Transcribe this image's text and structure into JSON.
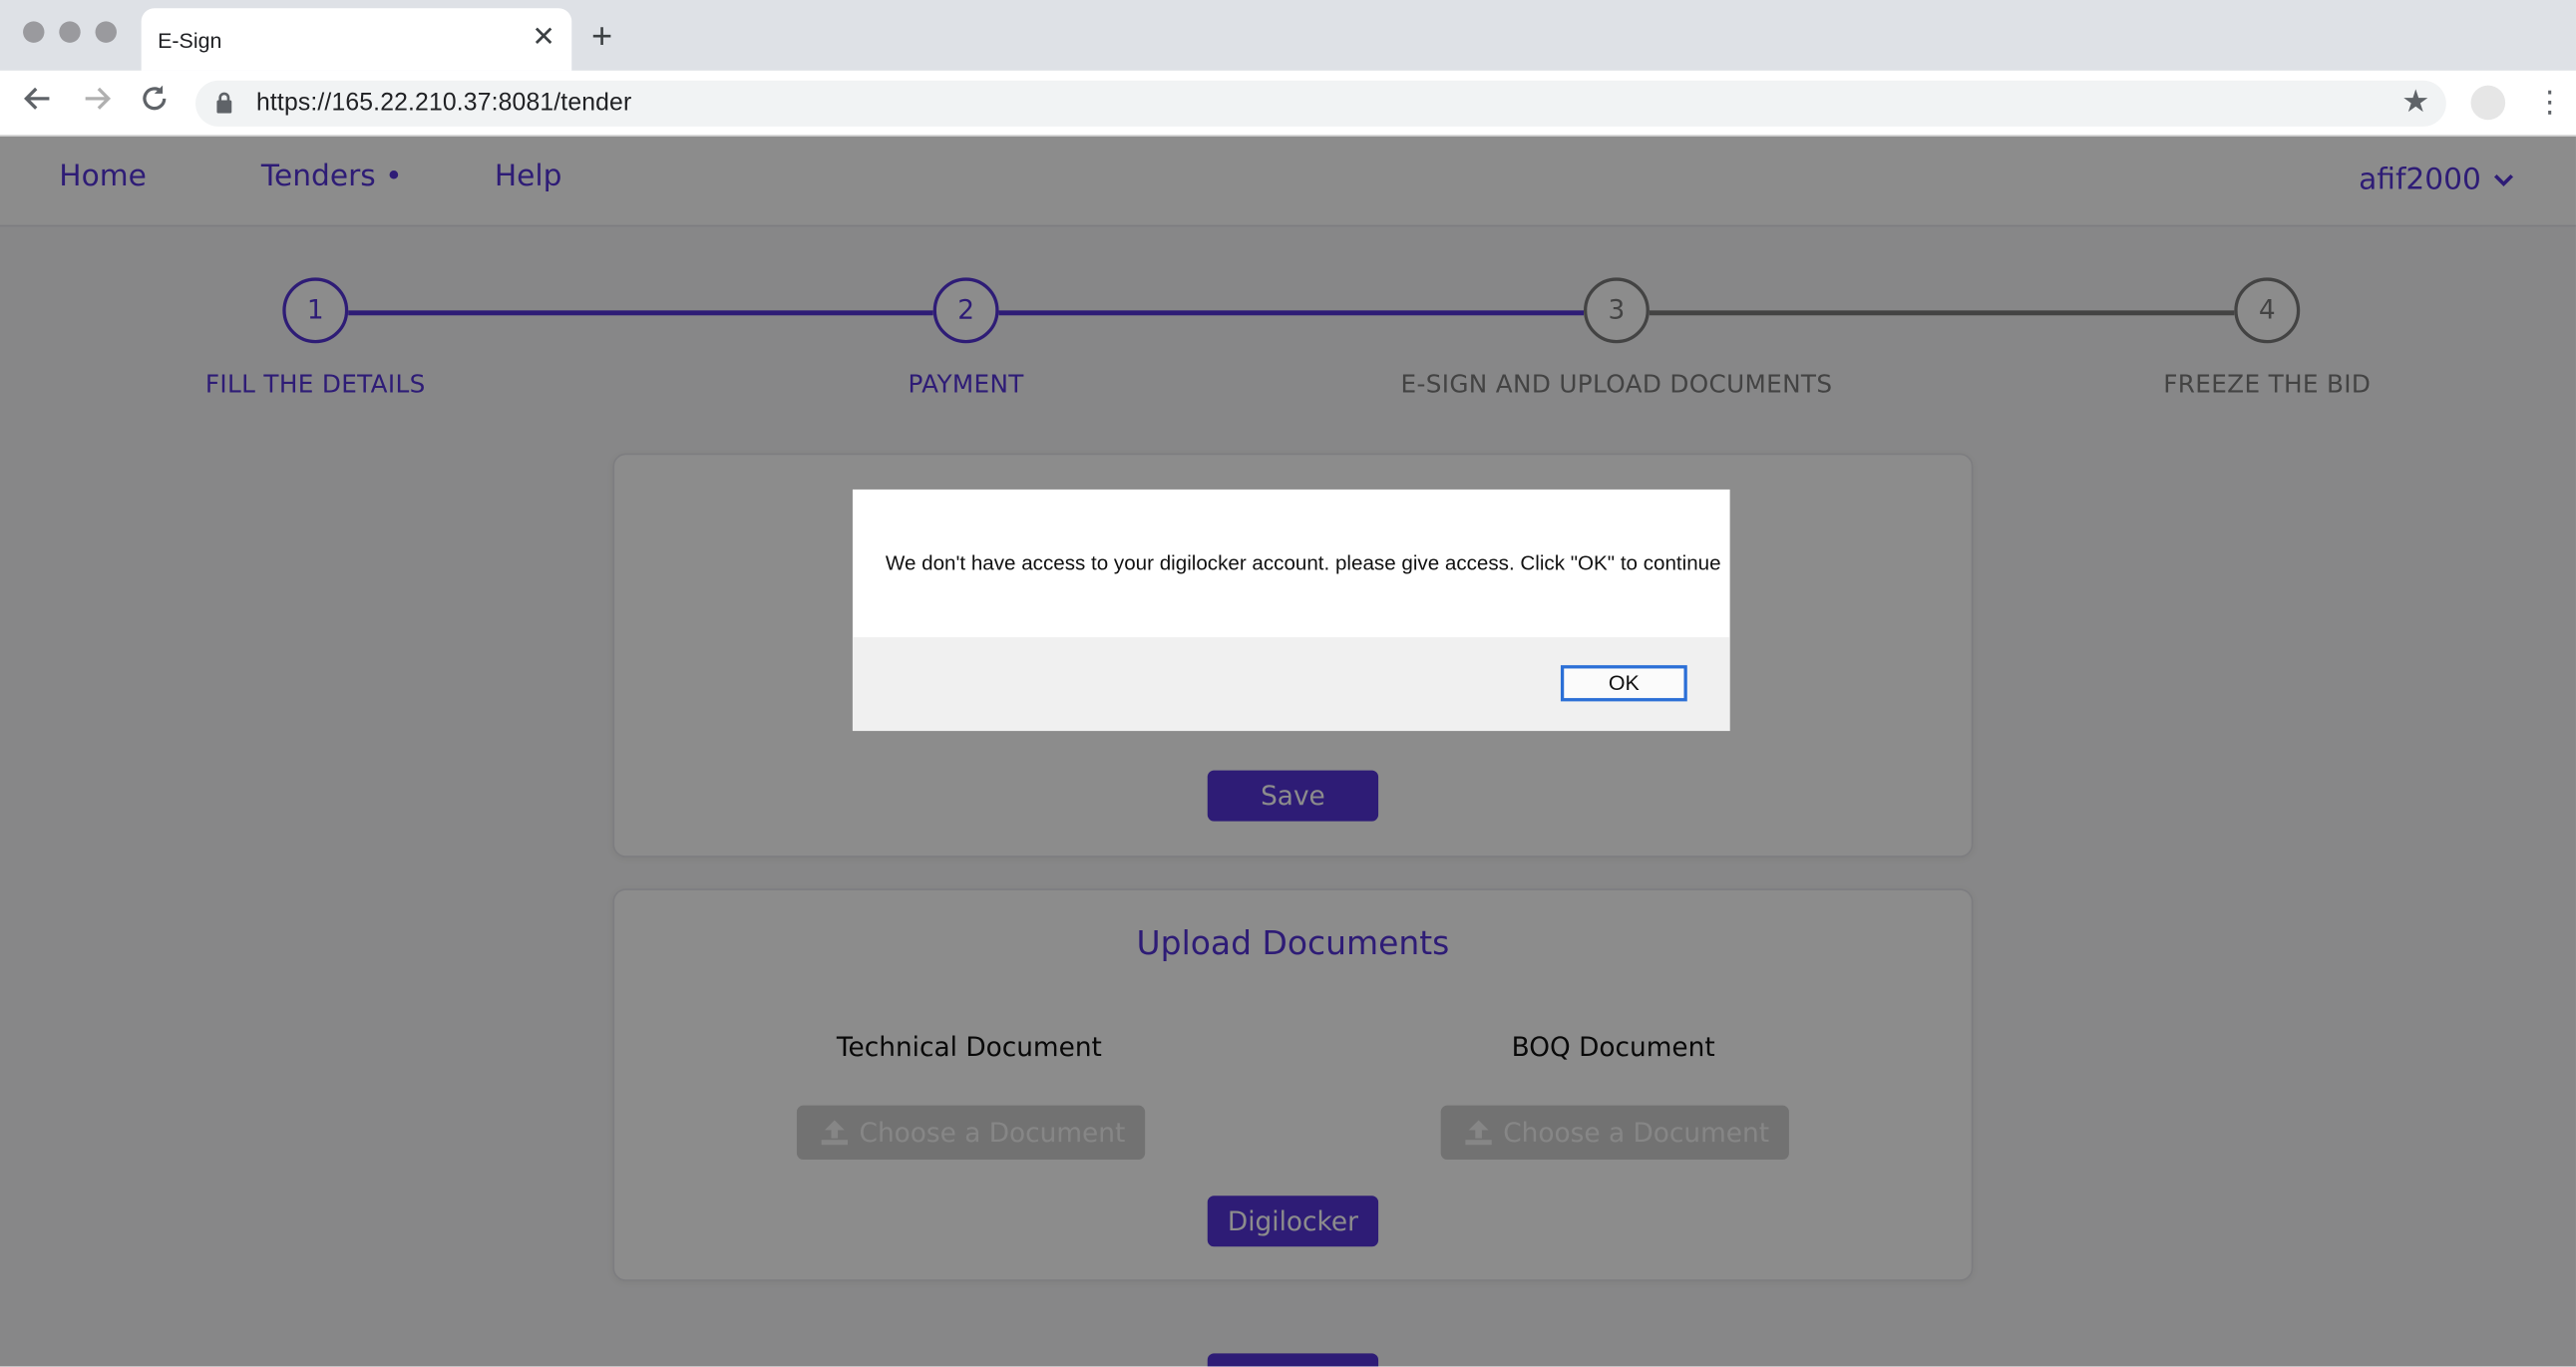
{
  "browser": {
    "tab_title": "E-Sign",
    "url": "https://165.22.210.37:8081/tender"
  },
  "nav": {
    "home": "Home",
    "tenders": "Tenders •",
    "help": "Help",
    "user": "afif2000"
  },
  "stepper": {
    "steps": [
      {
        "number": "1",
        "label": "FILL THE DETAILS",
        "state": "completed"
      },
      {
        "number": "2",
        "label": "PAYMENT",
        "state": "completed"
      },
      {
        "number": "3",
        "label": "E-SIGN AND UPLOAD DOCUMENTS",
        "state": "current"
      },
      {
        "number": "4",
        "label": "FREEZE THE BID",
        "state": "pending"
      }
    ]
  },
  "details_card": {
    "save_label": "Save"
  },
  "upload_card": {
    "title": "Upload Documents",
    "technical_label": "Technical Document",
    "boq_label": "BOQ Document",
    "choose_label": "Choose a Document",
    "digilocker_label": "Digilocker"
  },
  "dialog": {
    "message": "We don't have access to your digilocker account. please give access. Click \"OK\" to continue",
    "ok_label": "OK"
  },
  "colors": {
    "accent": "#5534d8",
    "inactive": "#7a7a7a",
    "overlay": "rgba(0,0,0,0.45)"
  }
}
